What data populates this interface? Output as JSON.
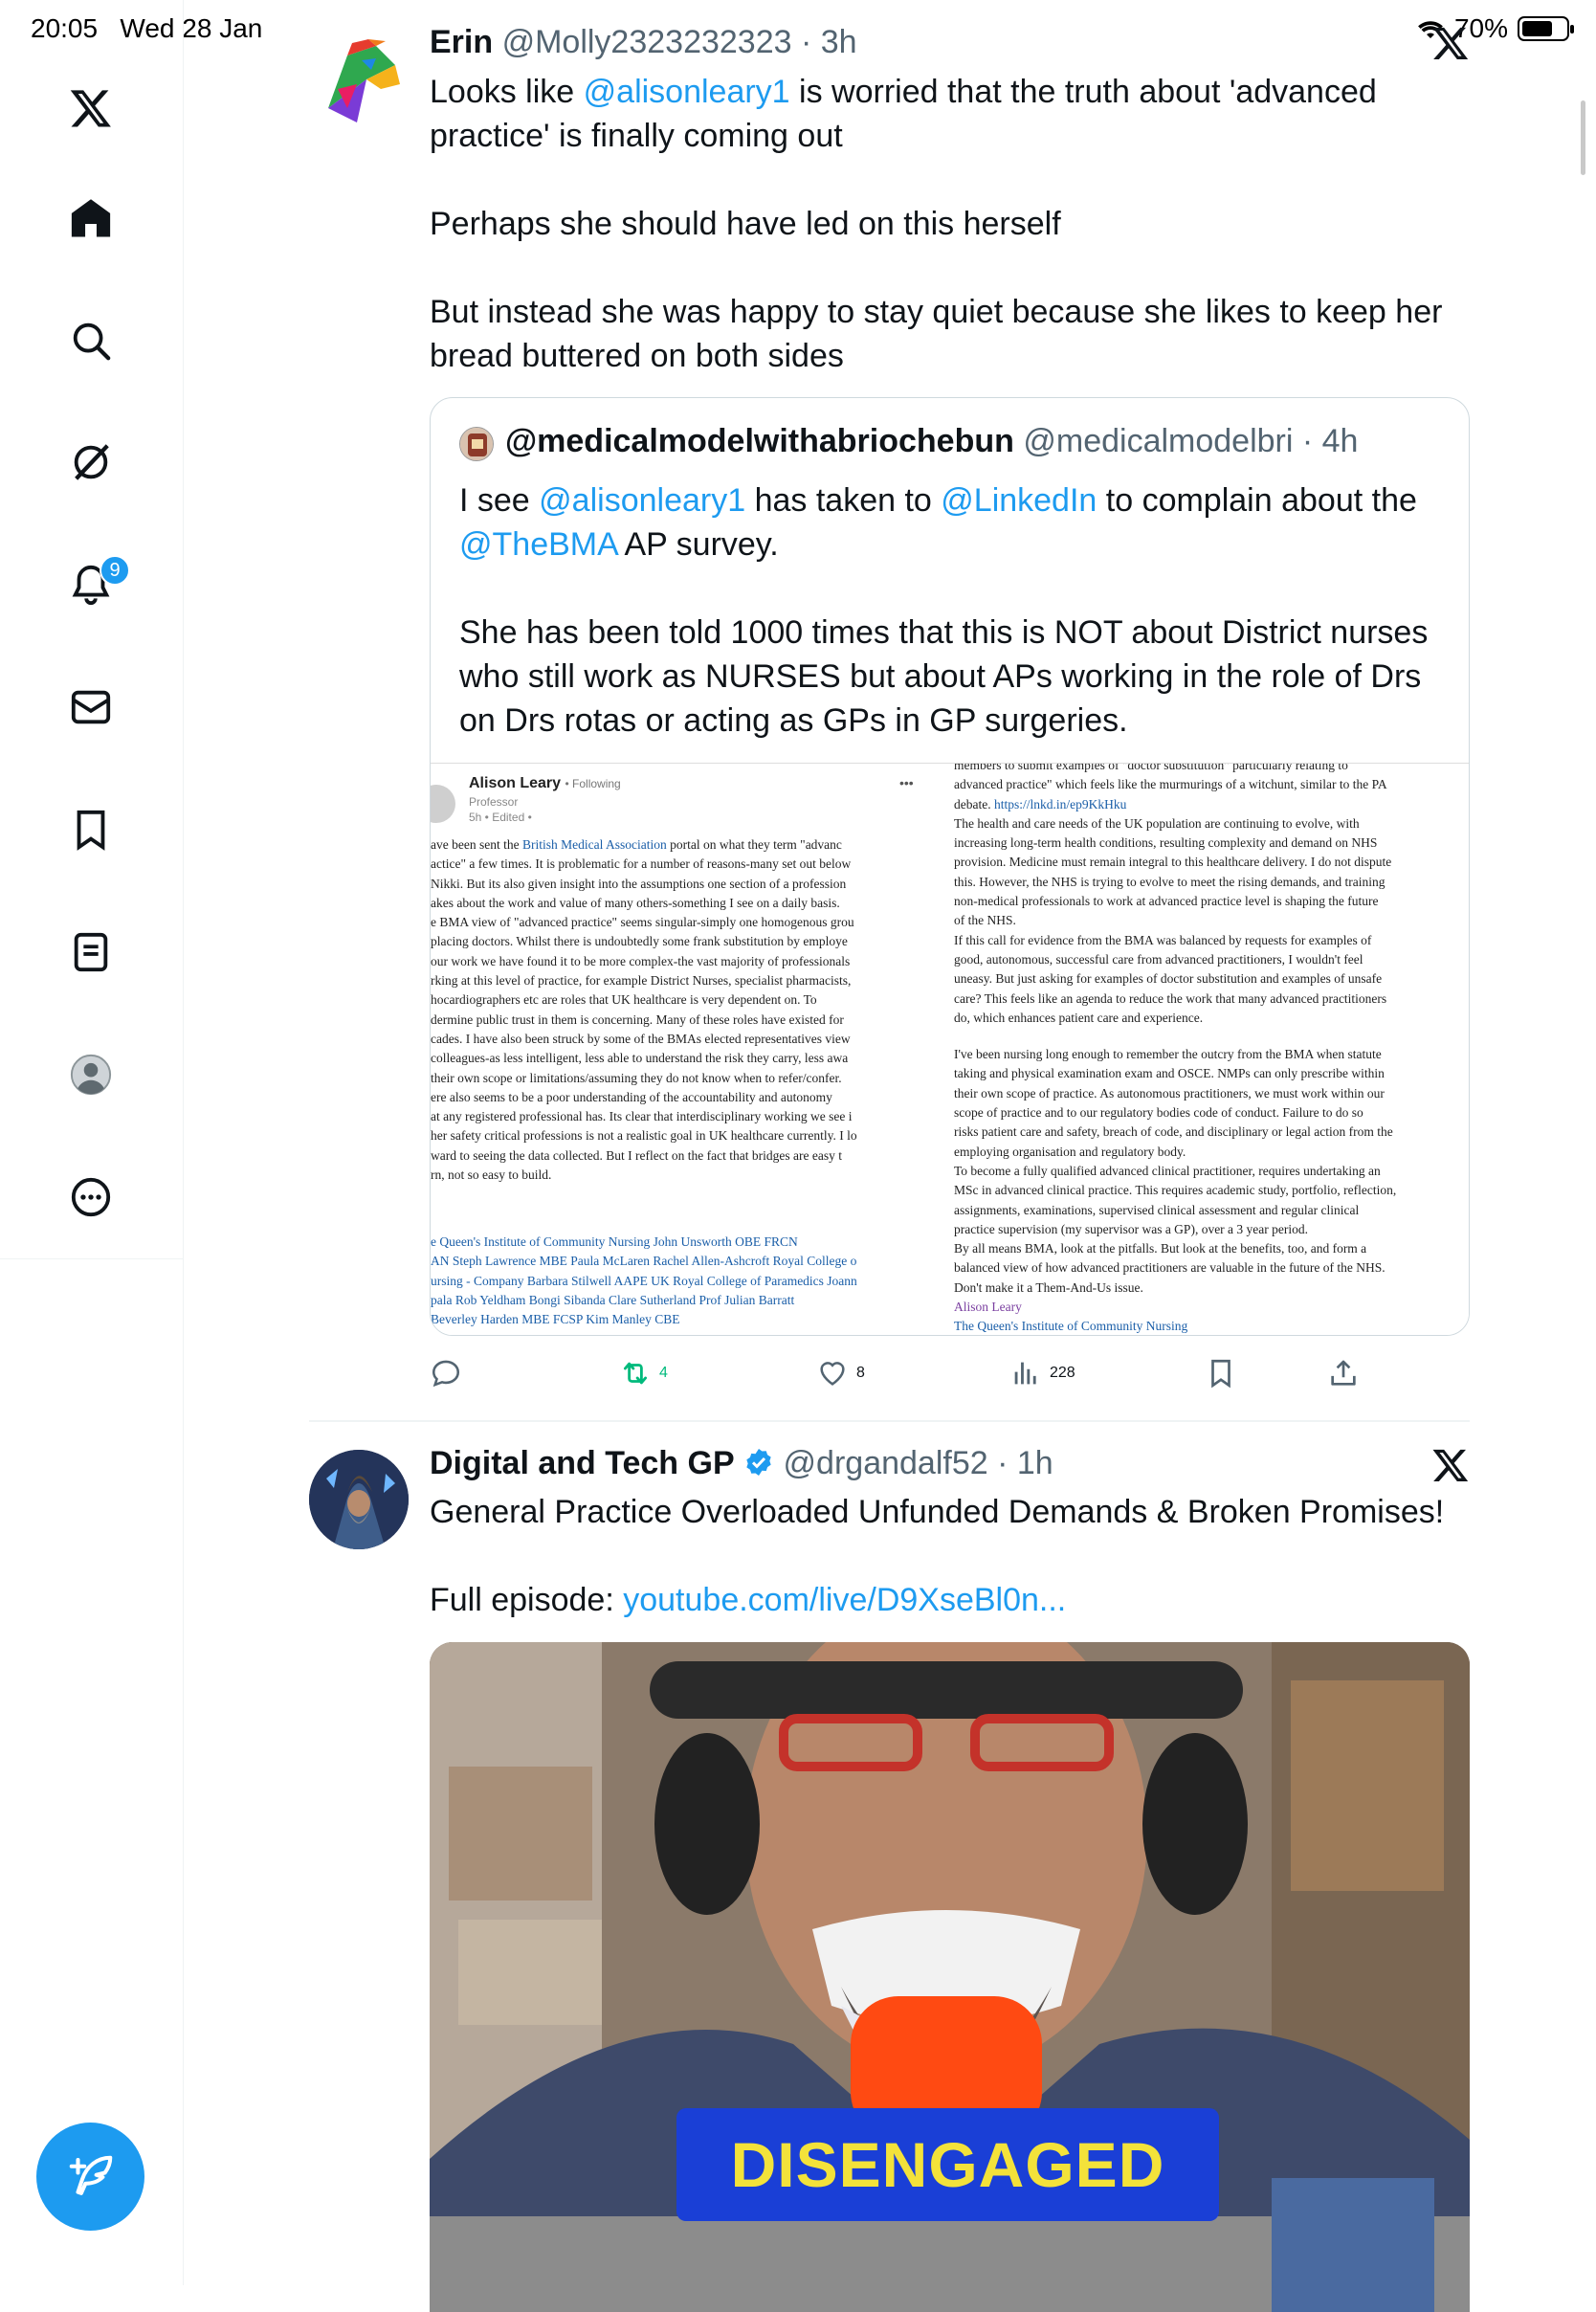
{
  "status_bar": {
    "time": "20:05",
    "date": "Wed 28 Jan",
    "battery": "70%",
    "battery_level": 0.7
  },
  "sidebar": {
    "items": [
      {
        "name": "x-logo-icon"
      },
      {
        "name": "home-icon"
      },
      {
        "name": "search-icon"
      },
      {
        "name": "grok-icon"
      },
      {
        "name": "notifications-icon"
      },
      {
        "name": "messages-icon"
      },
      {
        "name": "bookmarks-icon"
      },
      {
        "name": "lists-icon"
      },
      {
        "name": "profile-icon"
      },
      {
        "name": "more-icon"
      }
    ],
    "notifications_badge": "9"
  },
  "tweet1": {
    "name": "Erin",
    "handle": "@Molly2323232323",
    "time": "3h",
    "text_lines": [
      {
        "pre": "Looks like ",
        "mention": "@alisonleary1",
        "post": " is worried that the truth about 'advanced"
      },
      "practice' is finally coming out",
      "Perhaps she should have led on this herself",
      "But instead she was happy to stay quiet because she likes to keep her",
      "bread buttered on both sides"
    ],
    "quote": {
      "name": "@medicalmodelwithabriochebun",
      "handle": "@medicalmodelbri",
      "time": "4h",
      "line1": {
        "pre": "I see ",
        "m1": "@alisonleary1",
        "mid": " has taken to ",
        "m2": "@LinkedIn",
        "post": " to complain about the"
      },
      "line2": {
        "m": "@TheBMA",
        "post": " AP survey."
      },
      "para2": [
        "She has been told 1000 times that this is NOT about District nurses",
        "who still work as NURSES but about APs working in the role of Drs",
        "on Drs rotas or acting as GPs in GP surgeries."
      ],
      "image": {
        "author": "Alison Leary",
        "following": "• Following",
        "role": "Professor",
        "meta": "5h • Edited •",
        "more": "•••",
        "left_lines": [
          [
            "ave been sent the ",
            "British Medical Association",
            " portal on what they term \"advanc"
          ],
          [
            "actice\" a few times. It is problematic for a number of reasons-many set out below"
          ],
          [
            " Nikki. But its also given insight into the assumptions one section of a profession"
          ],
          [
            "akes about the work and value of many others-something I see on a daily basis."
          ],
          [
            "e BMA view of \"advanced practice\" seems singular-simply one homogenous grou"
          ],
          [
            "placing doctors. Whilst there is undoubtedly some frank substitution by employe"
          ],
          [
            "our work we have found it to be more complex-the vast majority of professionals"
          ],
          [
            "rking at this level of practice, for example District Nurses, specialist pharmacists,"
          ],
          [
            "hocardiographers etc are roles that UK healthcare is very dependent on. To"
          ],
          [
            "dermine public trust in them is concerning. Many of these roles have existed for"
          ],
          [
            "cades.  I have also been struck by some of the BMAs elected representatives view"
          ],
          [
            " colleagues-as less intelligent, less able to understand the risk they carry, less awa"
          ],
          [
            " their own scope or limitations/assuming they do not know when to refer/confer."
          ],
          [
            "ere also seems to be a poor understanding of the accountability and autonomy"
          ],
          [
            "at any registered professional has. Its clear that interdisciplinary working we see i"
          ],
          [
            "her safety critical professions is not a realistic goal in UK healthcare currently. I lo"
          ],
          [
            "ward to seeing the data collected. But I reflect on the fact that bridges are easy t"
          ],
          [
            "rn, not so easy to build."
          ]
        ],
        "left_tags": [
          "e Queen's Institute of Community Nursing John Unsworth OBE FRCN",
          "AN Steph Lawrence MBE Paula McLaren Rachel Allen-Ashcroft Royal College o",
          "ursing - Company Barbara Stilwell AAPE UK Royal College of Paramedics Joann",
          "pala Rob Yeldham Bongi Sibanda Clare Sutherland Prof Julian Barratt",
          " Beverley Harden MBE FCSP Kim Manley CBE"
        ],
        "right_lines": [
          "members to submit examples of \"doctor substitution\" particularly relating to",
          "advanced practice\" which feels like the murmurings of a witchunt, similar to the PA",
          "debate.",
          "The health and care needs of the UK population are continuing to evolve, with",
          "increasing long-term health conditions, resulting complexity and demand on NHS",
          "provision. Medicine must remain integral to this healthcare delivery. I do not dispute",
          "this. However, the NHS is trying to evolve to meet the rising demands, and training",
          "non-medical professionals to work at advanced practice level is shaping the future",
          "of the NHS.",
          "If this call for evidence from the BMA was balanced by requests for examples of",
          "good, autonomous, successful care from advanced practitioners, I wouldn't feel",
          "uneasy. But just asking for examples of doctor substitution and examples of unsafe",
          "care? This feels like an agenda to reduce the work that many advanced practitioners",
          "do, which enhances patient care and experience."
        ],
        "right_link": "https://lnkd.in/ep9KkHku",
        "right_lines2": [
          "I've been nursing long enough to remember the outcry from the BMA when statute",
          "taking and physical examination exam and OSCE. NMPs can only prescribe within",
          "their own scope of practice. As autonomous practitioners, we must work within our",
          "scope of practice and to our regulatory bodies code of conduct. Failure to do so",
          "risks patient care and safety, breach of code, and disciplinary or legal action from the",
          "employing organisation and regulatory body.",
          "To become a fully qualified advanced clinical practitioner, requires undertaking an",
          "MSc in advanced clinical practice. This requires academic study, portfolio, reflection,",
          "assignments, examinations, supervised clinical assessment and regular clinical",
          "practice supervision (my supervisor was a GP), over a 3 year period.",
          "By all means BMA, look at the pitfalls. But look at the benefits, too, and form a",
          "balanced view of how advanced practitioners are valuable in the future of the NHS.",
          "Don't make it a Them-And-Us issue."
        ],
        "right_sign": "Alison Leary",
        "right_org": "The Queen's Institute of Community Nursing"
      }
    },
    "actions": {
      "replies": "",
      "retweets": "4",
      "likes": "8",
      "views": "228"
    }
  },
  "tweet2": {
    "name": "Digital and Tech GP",
    "handle": "@drgandalf52",
    "time": "1h",
    "text": "General Practice Overloaded Unfunded Demands & Broken Promises!",
    "link_prefix": "Full episode: ",
    "link": "youtube.com/live/D9XseBl0n...",
    "video_banner": "DISENGAGED"
  }
}
